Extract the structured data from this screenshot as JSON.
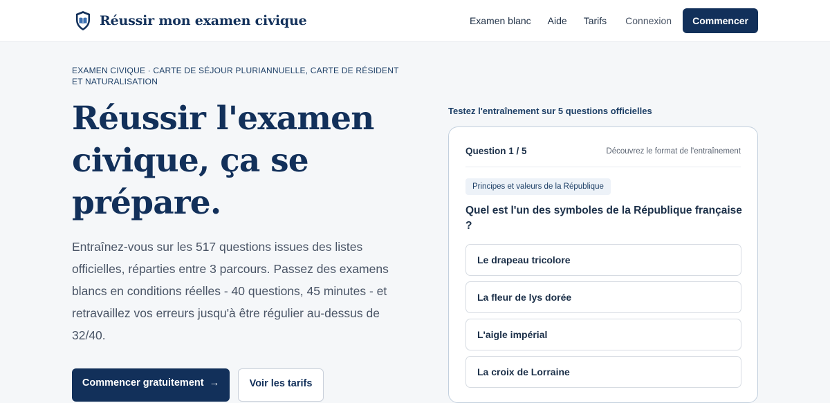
{
  "header": {
    "brand_name": "Réussir mon examen civique",
    "nav": [
      {
        "label": "Examen blanc"
      },
      {
        "label": "Aide"
      },
      {
        "label": "Tarifs"
      }
    ],
    "login_label": "Connexion",
    "cta_label": "Commencer"
  },
  "hero": {
    "kicker": "EXAMEN CIVIQUE · CARTE DE SÉJOUR PLURIANNUELLE, CARTE DE RÉSIDENT ET NATURALISATION",
    "title": "Réussir l'examen civique, ça se prépare.",
    "description": "Entraînez-vous sur les 517 questions issues des listes officielles, réparties entre 3 parcours. Passez des examens blancs en conditions réelles - 40 questions, 45 minutes - et retravaillez vos erreurs jusqu'à être régulier au-dessus de 32/40.",
    "primary_button": "Commencer gratuitement",
    "primary_button_arrow": "→",
    "secondary_button": "Voir les tarifs"
  },
  "quiz": {
    "intro": "Testez l'entraînement sur 5 questions officielles",
    "counter": "Question 1 / 5",
    "hint": "Découvrez le format de l'entraînement",
    "tag": "Principes et valeurs de la République",
    "question": "Quel est l'un des symboles de la République française ?",
    "answers": [
      "Le drapeau tricolore",
      "La fleur de lys dorée",
      "L'aigle impérial",
      "La croix de Lorraine"
    ]
  },
  "colors": {
    "brand": "#12305a",
    "background": "#f5f7f9",
    "card_border": "#c3d0de"
  },
  "icons": {
    "logo": "shield-book-icon",
    "arrow": "arrow-right-icon"
  }
}
